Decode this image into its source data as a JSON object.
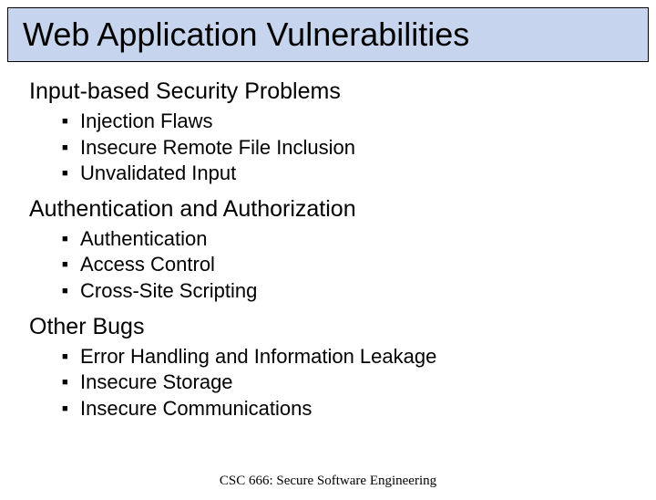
{
  "title": "Web Application Vulnerabilities",
  "sections": [
    {
      "heading": "Input-based Security Problems",
      "items": [
        "Injection Flaws",
        "Insecure Remote File Inclusion",
        "Unvalidated Input"
      ]
    },
    {
      "heading": "Authentication and Authorization",
      "items": [
        "Authentication",
        "Access Control",
        "Cross-Site Scripting"
      ]
    },
    {
      "heading": "Other Bugs",
      "items": [
        "Error Handling and Information Leakage",
        "Insecure Storage",
        "Insecure Communications"
      ]
    }
  ],
  "footer": "CSC 666: Secure Software Engineering"
}
